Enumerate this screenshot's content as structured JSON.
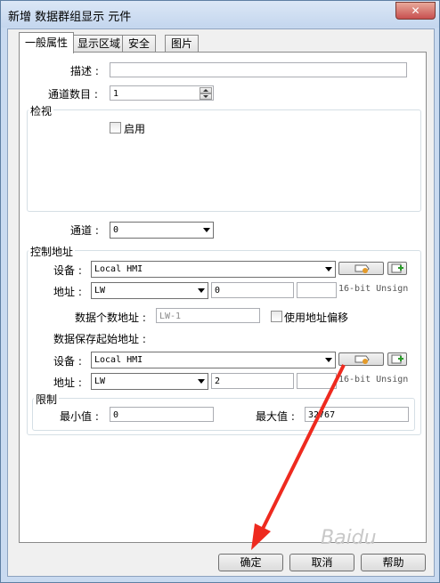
{
  "window": {
    "title": "新增 数据群组显示 元件",
    "close_label": "✕"
  },
  "tabs": [
    {
      "label": "一般属性"
    },
    {
      "label": "显示区域"
    },
    {
      "label": "安全"
    },
    {
      "label": "图片"
    }
  ],
  "form": {
    "desc_label": "描述 :",
    "desc_value": "",
    "channels_label": "通道数目 :",
    "channels_value": "1",
    "view_group": "检视",
    "enable_label": "启用",
    "channel_label": "通道 :",
    "channel_value": "0"
  },
  "control": {
    "group": "控制地址",
    "device_label": "设备 :",
    "device_value": "Local HMI",
    "addr_label": "地址 :",
    "addr_type": "LW",
    "addr_value": "0",
    "addr_format": "16-bit Unsign",
    "count_label": "数据个数地址 :",
    "count_value": "LW-1",
    "offset_label": "使用地址偏移",
    "save_label": "数据保存起始地址 :",
    "save_device_label": "设备 :",
    "save_device_value": "Local HMI",
    "save_addr_label": "地址 :",
    "save_addr_type": "LW",
    "save_addr_value": "2",
    "save_addr_format": "16-bit Unsign"
  },
  "limit": {
    "group": "限制",
    "min_label": "最小值 :",
    "min_value": "0",
    "max_label": "最大值 :",
    "max_value": "32767"
  },
  "buttons": {
    "ok": "确定",
    "cancel": "取消",
    "help": "帮助"
  },
  "watermark": "Baidu"
}
